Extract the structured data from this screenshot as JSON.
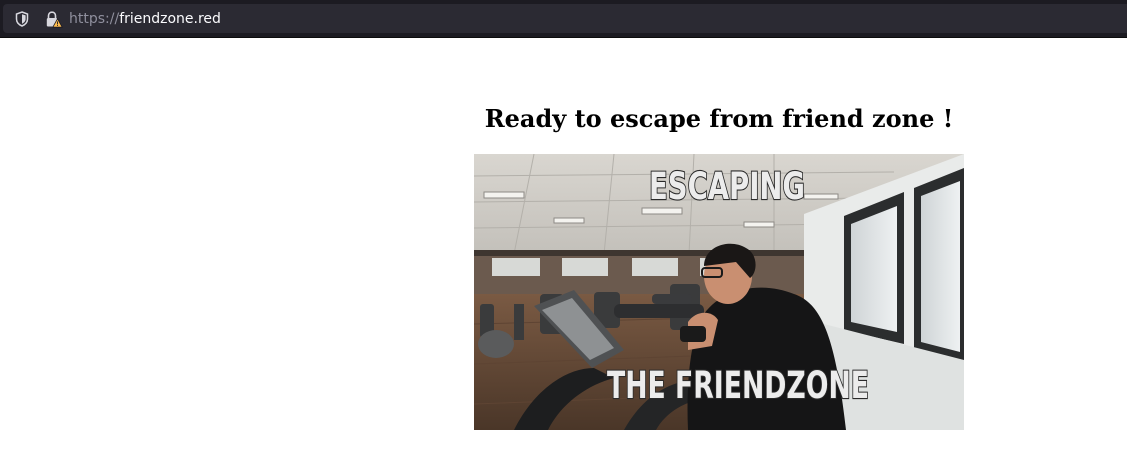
{
  "browser": {
    "url_scheme": "https://",
    "url_host": "friendzone.red",
    "icons": [
      "shield-icon",
      "lock-warning-icon"
    ]
  },
  "page": {
    "heading": "Ready to escape from friend zone !",
    "gif": {
      "caption_top": "ESCAPING",
      "caption_bottom": "THE FRIENDZONE"
    }
  },
  "colors": {
    "toolbar_bg": "#1c1b22",
    "urlfield_bg": "#2b2a33",
    "url_host_color": "#fbfbfe",
    "url_scheme_color": "#8f8f9d",
    "warning_yellow": "#ffbd4f",
    "page_bg": "#ffffff"
  }
}
